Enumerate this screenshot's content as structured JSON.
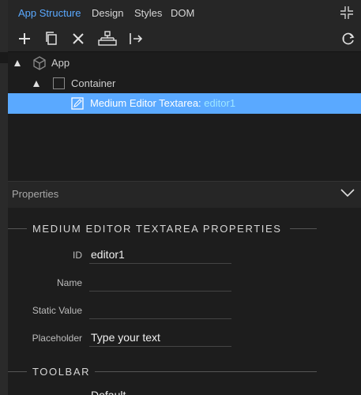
{
  "tabs": [
    "App Structure",
    "Design",
    "Styles",
    "DOM"
  ],
  "active_tab": "App Structure",
  "toolbar": {
    "icons": [
      "plus-icon",
      "copy-icon",
      "close-icon",
      "structure-icon",
      "insert-after-icon"
    ],
    "right_icon": "refresh-icon"
  },
  "tree": {
    "app": "App",
    "container": "Container",
    "selected_type": "Medium Editor Textarea:",
    "selected_id": "editor1"
  },
  "properties": {
    "title": "Properties",
    "section_heading": "MEDIUM EDITOR TEXTAREA PROPERTIES",
    "fields": [
      {
        "label": "ID",
        "value": "editor1"
      },
      {
        "label": "Name",
        "value": ""
      },
      {
        "label": "Static Value",
        "value": ""
      },
      {
        "label": "Placeholder",
        "value": "Type your text"
      }
    ],
    "toolbar_heading": "TOOLBAR",
    "partial_value": "Default"
  },
  "colors": {
    "accent": "#5aa9ff",
    "selected_id": "#9ee6ff"
  }
}
